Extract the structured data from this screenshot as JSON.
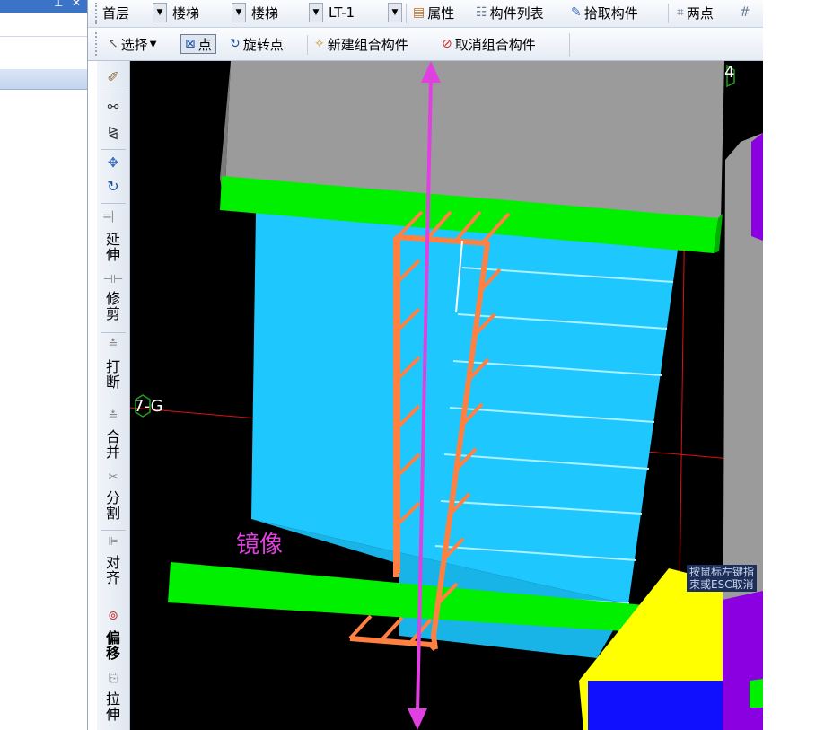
{
  "toolbar1": {
    "floor_value": "首层",
    "category_value": "楼梯",
    "type_value": "楼梯",
    "component_value": "LT-1",
    "properties_label": "属性",
    "component_list_label": "构件列表",
    "pick_component_label": "拾取构件",
    "two_points_label": "两点"
  },
  "toolbar2": {
    "select_label": "选择",
    "point_label": "点",
    "rotate_point_label": "旋转点",
    "new_group_label": "新建组合构件",
    "cancel_group_label": "取消组合构件"
  },
  "tools": {
    "extend": "延伸",
    "trim": "修剪",
    "break": "打断",
    "merge": "合并",
    "split": "分割",
    "align": "对齐",
    "offset": "偏移",
    "stretch": "拉伸"
  },
  "viewport": {
    "grid_label_left": "7-G",
    "grid_label_top": "4",
    "mirror_label": "镜像",
    "tooltip_line1": "按鼠标左键指",
    "tooltip_line2": "束或ESC取消"
  },
  "colors": {
    "accent_blue": "#3b73c6",
    "slab_gray": "#9b9b9b",
    "beam_green": "#00f000",
    "stair_cyan": "#1ec8ff",
    "rebar_orange": "#ff8040",
    "mirror_magenta": "#e040e0",
    "yellow_block": "#ffff00",
    "purple_block": "#8a00e0",
    "blue_block": "#1010ff"
  }
}
